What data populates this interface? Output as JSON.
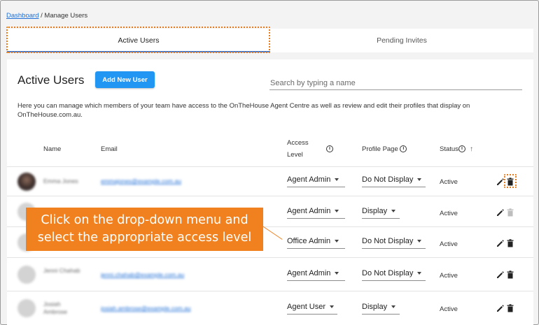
{
  "breadcrumb": {
    "home": "Dashboard",
    "separator": "/",
    "current": "Manage Users"
  },
  "tabs": [
    {
      "label": "Active Users",
      "active": true
    },
    {
      "label": "Pending Invites",
      "active": false
    }
  ],
  "panel": {
    "title": "Active Users",
    "add_button": "Add New User",
    "search_placeholder": "Search by typing a name",
    "description": "Here you can manage which members of your team have access to the OnTheHouse Agent Centre as well as review and edit their profiles that display on OnTheHouse.com.au."
  },
  "columns": {
    "name": "Name",
    "email": "Email",
    "access_level_line1": "Access",
    "access_level_line2": "Level",
    "profile_page": "Profile Page",
    "status": "Status"
  },
  "rows": [
    {
      "name": "Emma Jones",
      "email": "emmajones@example.com.au",
      "access_level": "Agent Admin",
      "profile_page": "Do Not Display",
      "status": "Active"
    },
    {
      "name": "",
      "email": "",
      "access_level": "Agent Admin",
      "profile_page": "Display",
      "status": "Active"
    },
    {
      "name": "",
      "email": "",
      "access_level": "Office Admin",
      "profile_page": "Do Not Display",
      "status": "Active"
    },
    {
      "name": "Jenni Chahab",
      "email": "jenni.chahab@example.com.au",
      "access_level": "Agent Admin",
      "profile_page": "Do Not Display",
      "status": "Active"
    },
    {
      "name": "Josiah Ambrose",
      "email": "josiah.ambrose@example.com.au",
      "access_level": "Agent User",
      "profile_page": "Display",
      "status": "Active"
    }
  ],
  "callout": {
    "line1": "Click on the drop-down menu and",
    "line2": "select the appropriate access level"
  },
  "colors": {
    "accent": "#2196f3",
    "callout": "#f0811e",
    "link": "#1f6fd6"
  },
  "icons": [
    "info-icon",
    "sort-arrow-up-icon",
    "edit-pencil-icon",
    "trash-icon",
    "caret-down-icon"
  ]
}
